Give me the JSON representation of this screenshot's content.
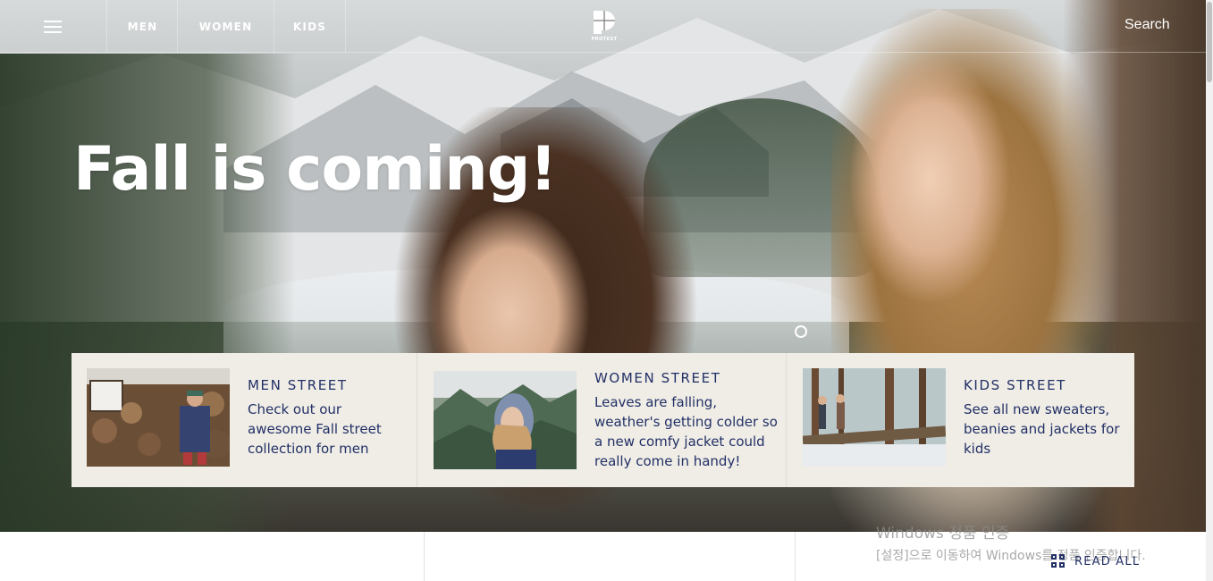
{
  "nav": {
    "menu_icon": "hamburger-icon",
    "links": [
      "MEN",
      "WOMEN",
      "KIDS"
    ],
    "logo_text": "PROTEST",
    "search_label": "Search"
  },
  "hero": {
    "headline": "Fall is coming!"
  },
  "cards": [
    {
      "title": "MEN STREET",
      "description": "Check out our awesome Fall street collection for men"
    },
    {
      "title": "WOMEN STREET",
      "description": "Leaves are falling, weather's getting colder so a new comfy jacket could really come in handy!"
    },
    {
      "title": "KIDS STREET",
      "description": "See all new sweaters, beanies and jackets for kids"
    }
  ],
  "read_all": {
    "label": "READ ALL",
    "icon": "grid-icon"
  },
  "windows_watermark": {
    "line1": "Windows 정품 인증",
    "line2": "[설정]으로 이동하여 Windows를 정품 인증합니다."
  },
  "colors": {
    "accent": "#233066",
    "card_background": "#efede6",
    "nav_text": "#ffffff"
  }
}
